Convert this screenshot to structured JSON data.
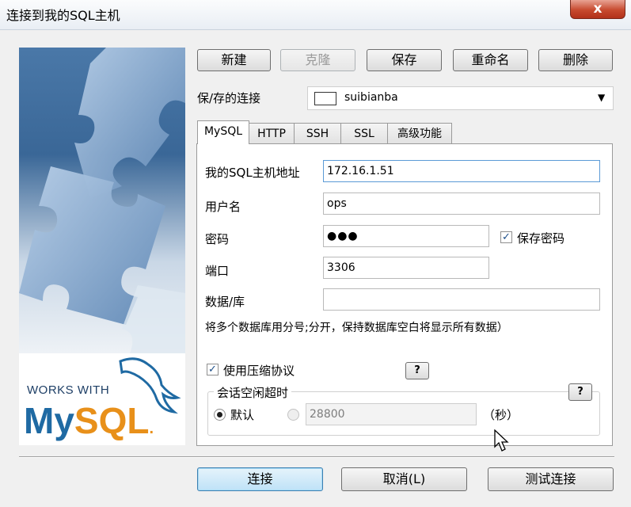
{
  "window": {
    "title": "连接到我的SQL主机",
    "close_glyph": "x"
  },
  "banner": {
    "works_with": "WORKS WITH",
    "logo_my": "My",
    "logo_sql": "SQL",
    "logo_dot": ".",
    "logo_colors": {
      "my": "#1f6aa3",
      "sql": "#e8901a"
    }
  },
  "toolbar": {
    "new_label": "新建",
    "clone_label": "克隆",
    "save_label": "保存",
    "rename_label": "重命名",
    "delete_label": "删除"
  },
  "saved_connection": {
    "label": "保/存的连接",
    "value": "suibianba",
    "icon": "chevron-down-icon"
  },
  "tabs": [
    {
      "label": "MySQL",
      "active": true
    },
    {
      "label": "HTTP",
      "active": false
    },
    {
      "label": "SSH",
      "active": false
    },
    {
      "label": "SSL",
      "active": false
    },
    {
      "label": "高级功能",
      "active": false
    }
  ],
  "mysql": {
    "host_label": "我的SQL主机地址",
    "host_value": "172.16.1.51",
    "user_label": "用户名",
    "user_value": "ops",
    "password_label": "密码",
    "password_value": "●●●",
    "save_password_label": "保存密码",
    "save_password_checked": true,
    "port_label": "端口",
    "port_value": "3306",
    "database_label": "数据/库",
    "database_value": "",
    "database_hint": "将多个数据库用分号;分开，保持数据库空白将显示所有数据）",
    "compression_label": "使用压缩协议",
    "compression_checked": true,
    "help_label": "?",
    "idle_group_label": "会话空闲超时",
    "idle_default_label": "默认",
    "idle_default_selected": true,
    "idle_custom_value": "28800",
    "idle_unit_label": "（秒）"
  },
  "footer": {
    "connect_label": "连接",
    "cancel_label": "取消(L)",
    "test_label": "测试连接"
  }
}
